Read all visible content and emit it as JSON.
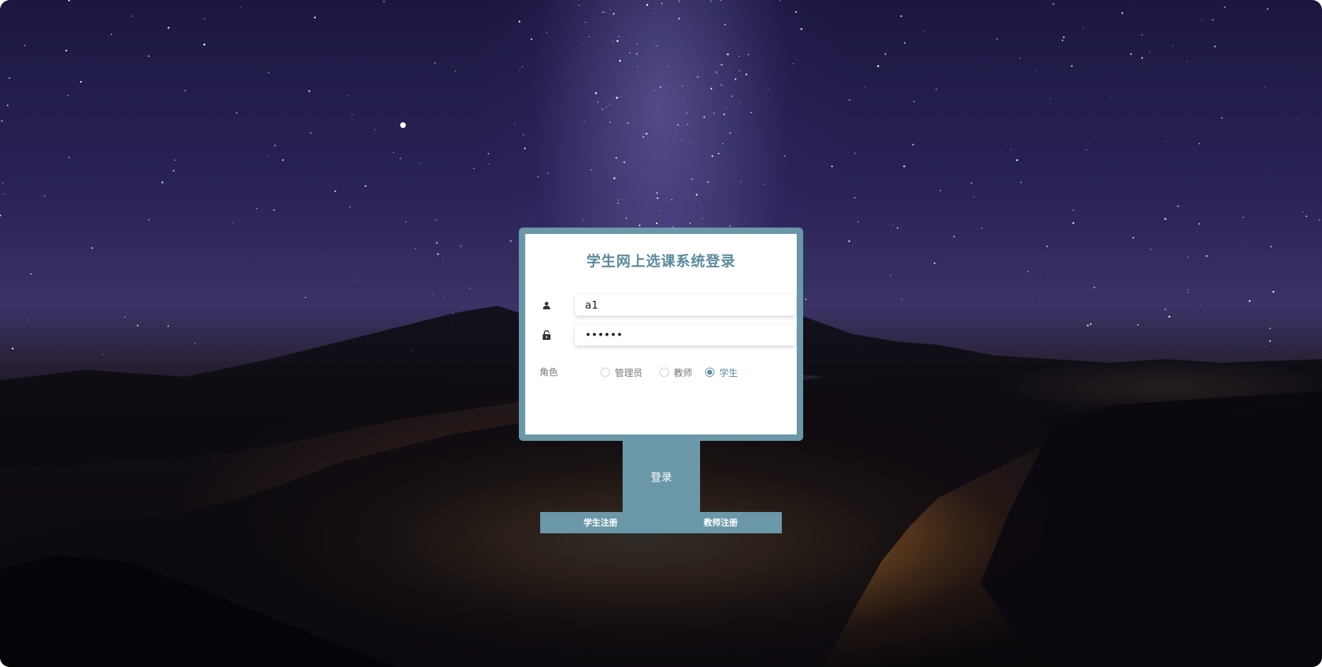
{
  "page": {
    "title": "学生网上选课系统登录"
  },
  "form": {
    "username_value": "a1",
    "password_value": "••••••",
    "role_label": "角色",
    "roles": [
      {
        "label": "管理员",
        "checked": false
      },
      {
        "label": "教师",
        "checked": false
      },
      {
        "label": "学生",
        "checked": true
      }
    ],
    "login_label": "登录",
    "student_register_label": "学生注册",
    "teacher_register_label": "教师注册"
  },
  "colors": {
    "accent": "#6a98a8",
    "title": "#5b8a9d"
  },
  "icons": {
    "username": "user-icon",
    "password": "lock-icon"
  }
}
